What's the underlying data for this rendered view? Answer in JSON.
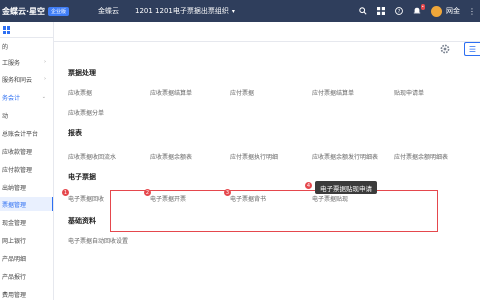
{
  "topbar": {
    "brand": "金蝶云·星空",
    "brand_badge": "企业版",
    "company": "金蝶云",
    "org": "1201  1201电子票据出票组织",
    "user": "网金"
  },
  "sidebar": {
    "items": [
      {
        "label": "的"
      },
      {
        "label": "工服务"
      },
      {
        "label": "服务和同云"
      },
      {
        "label": "务会计"
      },
      {
        "label": "动"
      },
      {
        "label": "总账会计平台"
      },
      {
        "label": "应收款管理"
      },
      {
        "label": "应付款管理"
      },
      {
        "label": "出纳管理"
      },
      {
        "label": "票据管理"
      },
      {
        "label": "现金管理"
      },
      {
        "label": "网上银行"
      },
      {
        "label": "产品明细"
      },
      {
        "label": "产品报行"
      },
      {
        "label": "费用管理"
      }
    ]
  },
  "sections": {
    "bill_processing": {
      "title": "票据处理",
      "links": [
        "应收票据",
        "应收票据结算单",
        "应付票据",
        "应付票据结算单",
        "贴现申请单",
        "应收票据分单"
      ]
    },
    "reports": {
      "title": "报表",
      "links": [
        "应收票据收回流水",
        "应收票据余额表",
        "应付票据执行明细",
        "应收票据余额发行明细表",
        "应付票据余额明细表"
      ]
    },
    "electronic_bills": {
      "title": "电子票据",
      "links": [
        "电子票据回收",
        "电子票据开票",
        "电子票据背书",
        "电子票据贴现"
      ],
      "tooltip": "电子票据贴现申请",
      "badges": [
        "1",
        "2",
        "3",
        "4"
      ]
    },
    "basic_data": {
      "title": "基础资料",
      "links": [
        "电子票据自动回收设置"
      ]
    }
  }
}
